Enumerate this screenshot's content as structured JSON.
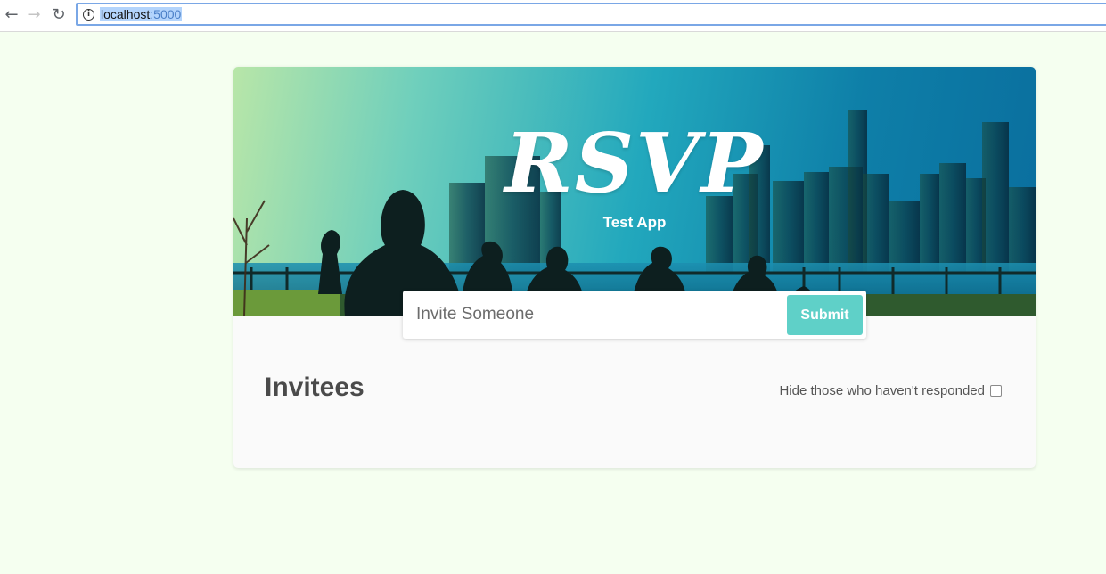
{
  "browser": {
    "back_icon": "arrow-left-icon",
    "forward_icon": "arrow-right-icon",
    "reload_icon": "reload-icon",
    "info_icon": "info-icon",
    "url_host": "localhost",
    "url_port": ":5000"
  },
  "header": {
    "logo": "RSVP",
    "subtitle": "Test App"
  },
  "invite_form": {
    "placeholder": "Invite Someone",
    "submit_label": "Submit"
  },
  "main": {
    "title": "Invitees",
    "filter_label": "Hide those who haven't responded",
    "filter_checked": false
  },
  "colors": {
    "page_background": "#f5fff0",
    "accent": "#5fd0c8",
    "card_background": "#fafafa",
    "heading_text": "#4a4a4a"
  }
}
